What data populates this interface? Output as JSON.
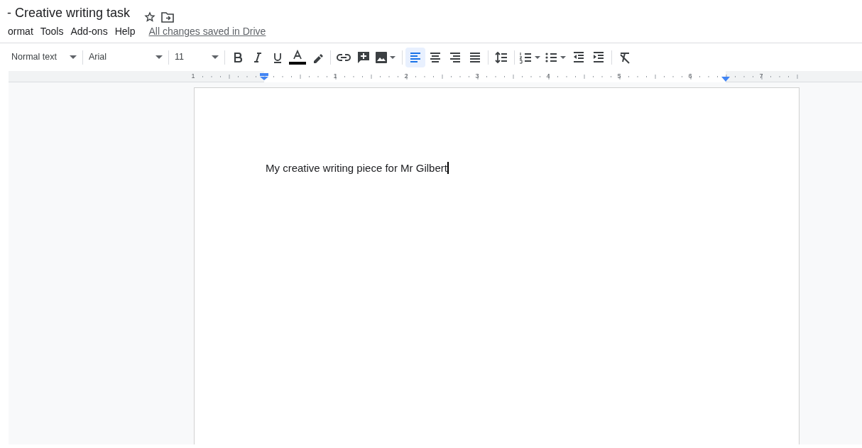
{
  "document": {
    "title": "- Creative writing task"
  },
  "menu": [
    "ormat",
    "Tools",
    "Add-ons",
    "Help"
  ],
  "save_status": "All changes saved in Drive",
  "toolbar": {
    "style": "Normal text",
    "font": "Arial",
    "size": "11",
    "alignment": [
      {
        "kind": "left",
        "selected": true
      },
      {
        "kind": "center",
        "selected": false
      },
      {
        "kind": "right",
        "selected": false
      },
      {
        "kind": "justify",
        "selected": false
      }
    ]
  },
  "ruler": {
    "labels": [
      "1",
      "1",
      "2",
      "3",
      "4",
      "5",
      "6",
      "7"
    ]
  },
  "body": {
    "text": "My creative writing piece for Mr Gilbert"
  }
}
